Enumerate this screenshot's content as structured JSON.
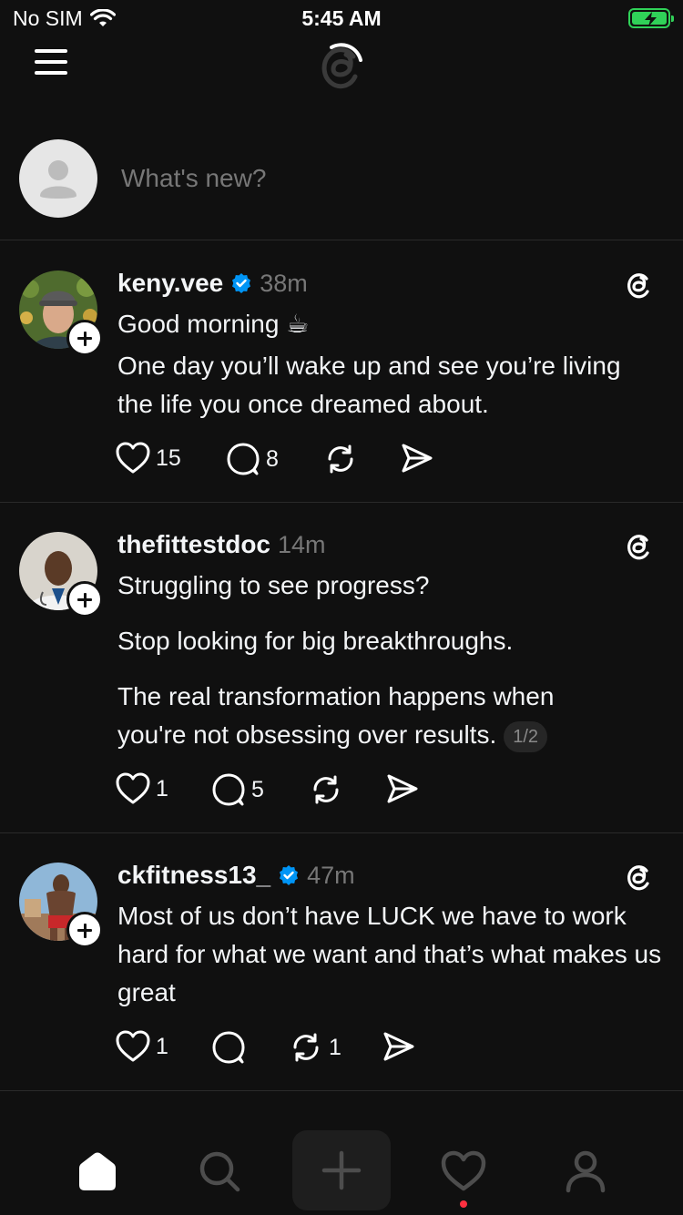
{
  "status_bar": {
    "carrier": "No SIM",
    "time": "5:45 AM"
  },
  "composer": {
    "placeholder": "What's new?"
  },
  "posts": [
    {
      "username": "keny.vee",
      "verified": true,
      "timestamp": "38m",
      "lines": [
        "Good morning ☕",
        "One day you’ll wake up and see you’re living the life you once dreamed about."
      ],
      "likes": "15",
      "replies": "8",
      "reposts": ""
    },
    {
      "username": "thefittestdoc",
      "verified": false,
      "timestamp": "14m",
      "lines": [
        "Struggling to see progress?",
        "Stop looking for big breakthroughs.",
        "The real transformation happens when you're not obsessing over results."
      ],
      "page_indicator": "1/2",
      "likes": "1",
      "replies": "5",
      "reposts": ""
    },
    {
      "username": "ckfitness13_",
      "verified": true,
      "timestamp": "47m",
      "lines": [
        "Most of us don’t have LUCK we have to work hard for what we want and that’s what makes us great"
      ],
      "likes": "1",
      "replies": "",
      "reposts": "1"
    }
  ],
  "tabs": [
    "home",
    "search",
    "create",
    "activity",
    "profile"
  ],
  "colors": {
    "background": "#101010",
    "verified": "#0095f6",
    "notification": "#ff3040"
  }
}
